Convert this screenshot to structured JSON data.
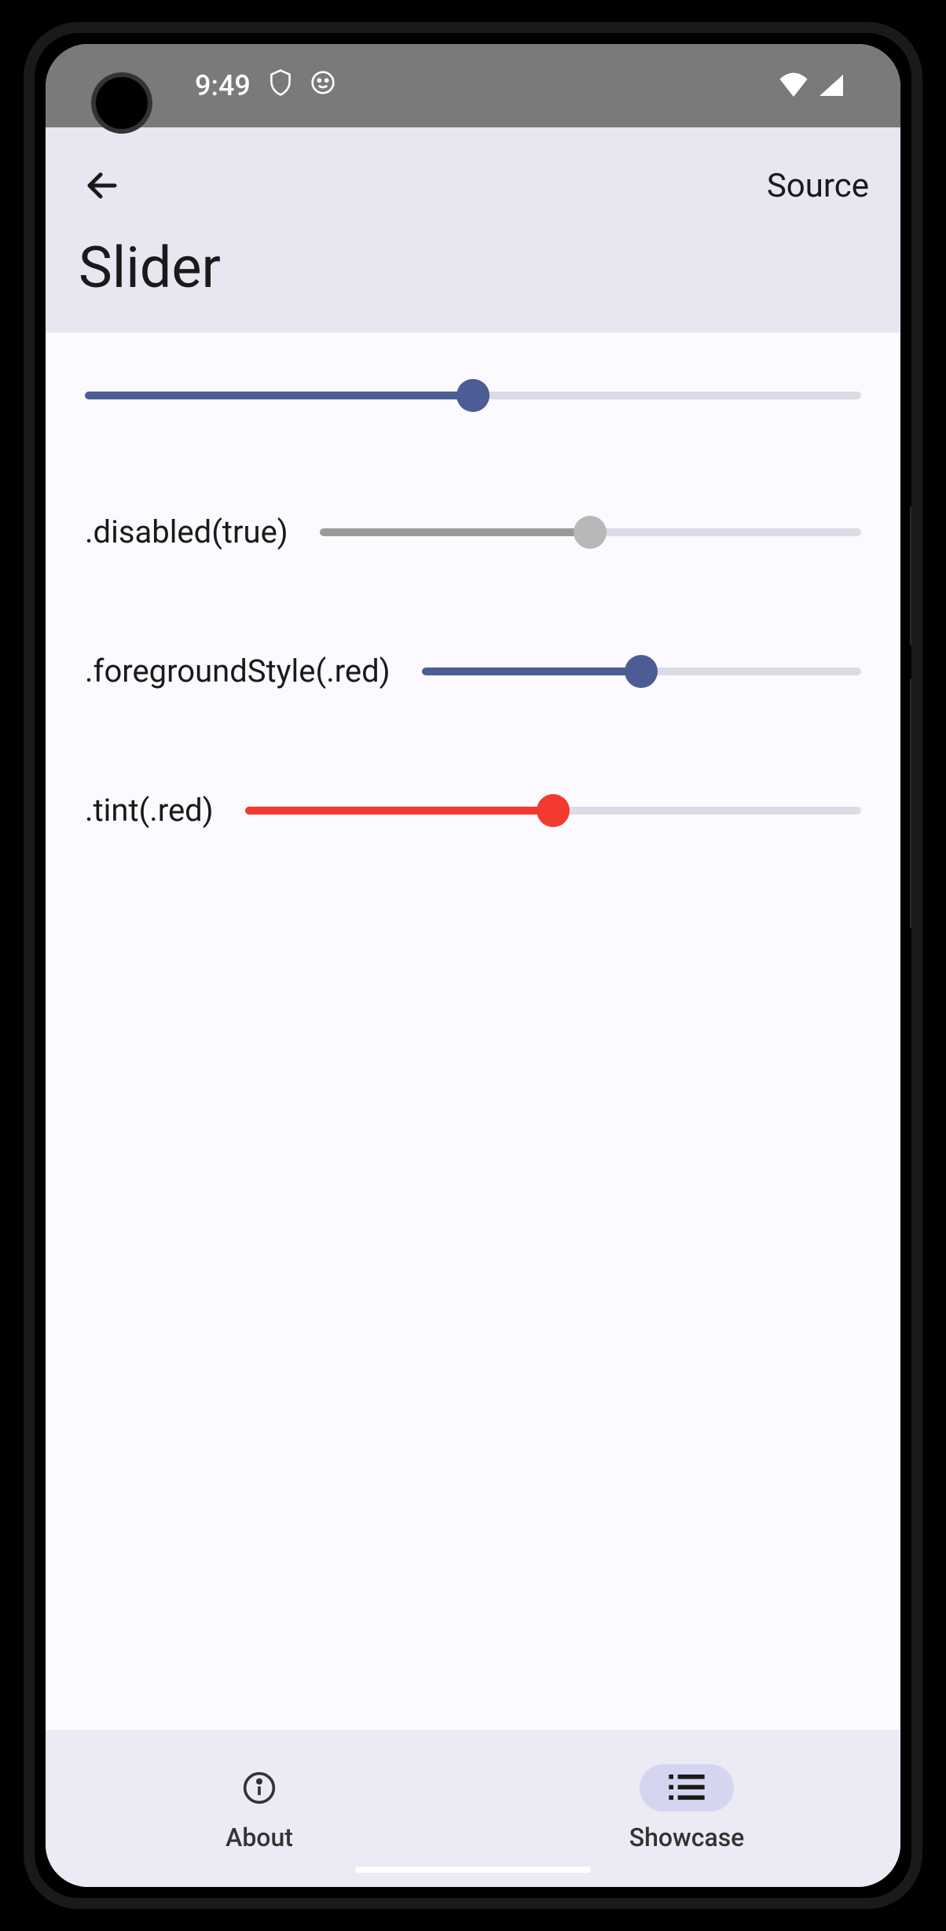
{
  "status": {
    "time": "9:49"
  },
  "header": {
    "back": "←",
    "source": "Source",
    "title": "Slider"
  },
  "colors": {
    "primary": "#4c5c94",
    "disabled": "#9a9a9a",
    "red": "#f23a2f",
    "trackBg": "#dcdce6"
  },
  "sliders": [
    {
      "label": "",
      "value": 50,
      "fgColor": "#4c5c94",
      "thumbColor": "#4c5c94"
    },
    {
      "label": ".disabled(true)",
      "value": 50,
      "fgColor": "#9a9a9a",
      "thumbColor": "#b8b8b8"
    },
    {
      "label": ".foregroundStyle(.red)",
      "value": 50,
      "fgColor": "#4c5c94",
      "thumbColor": "#4c5c94"
    },
    {
      "label": ".tint(.red)",
      "value": 50,
      "fgColor": "#f23a2f",
      "thumbColor": "#f23a2f"
    }
  ],
  "nav": {
    "about": "About",
    "showcase": "Showcase"
  }
}
